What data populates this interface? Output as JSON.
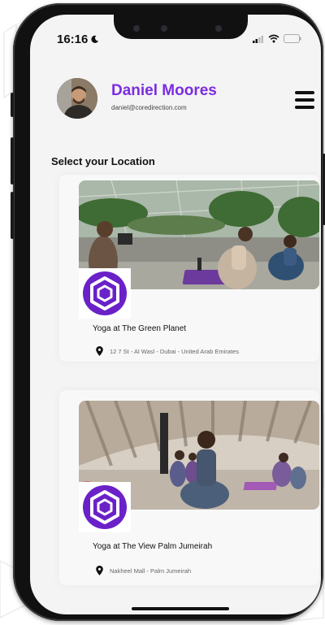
{
  "status_bar": {
    "time": "16:16"
  },
  "profile": {
    "name": "Daniel Moores",
    "email": "daniel@coredirection.com"
  },
  "section_title": "Select your Location",
  "locations": [
    {
      "title": "Yoga at The Green Planet",
      "address": "12 7 St - Al Wasl - Dubai - United Arab Emirates"
    },
    {
      "title": "Yoga at The View Palm Jumeirah",
      "address": "Nakheel Mall - Palm Jumeirah"
    }
  ],
  "colors": {
    "accent": "#7c2ce0",
    "logo": "#6a21c8"
  },
  "icons": [
    "moon-icon",
    "signal-icon",
    "wifi-icon",
    "battery-icon",
    "menu-icon",
    "location-pin-icon",
    "hexagon-logo-icon"
  ]
}
